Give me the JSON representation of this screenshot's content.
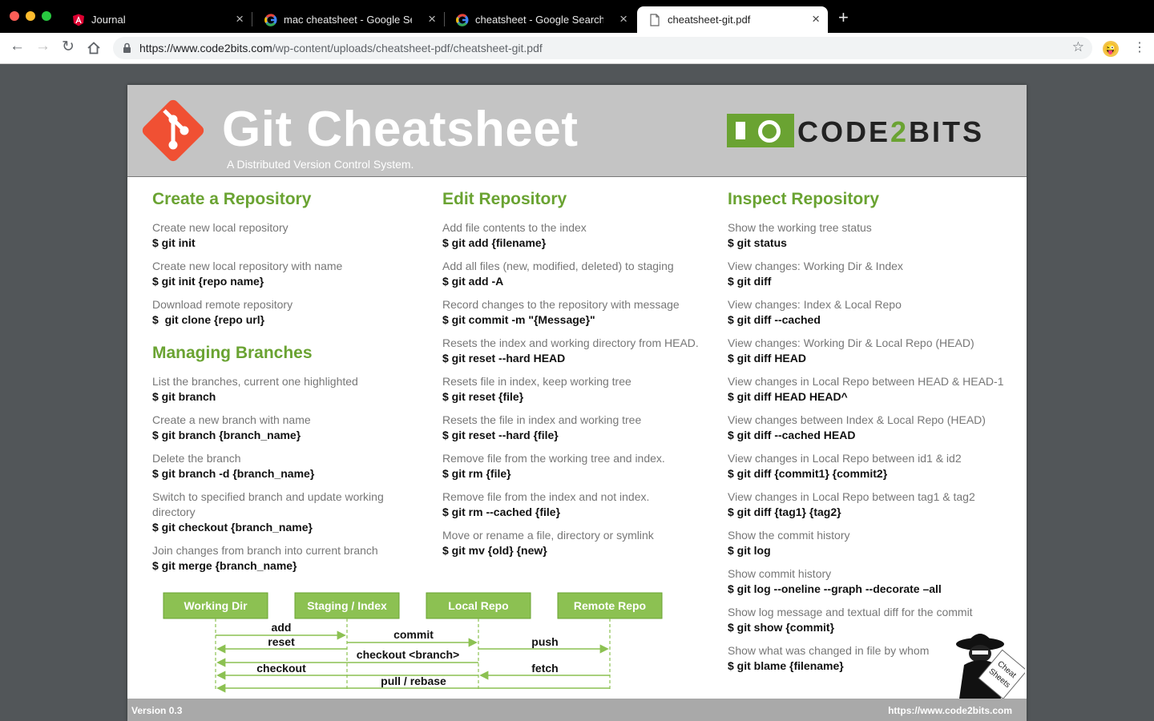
{
  "browser": {
    "tabs": [
      {
        "title": "Journal",
        "icon": "angular-icon"
      },
      {
        "title": "mac cheatsheet - Google Search",
        "icon": "google-icon"
      },
      {
        "title": "cheatsheet - Google Search",
        "icon": "google-icon"
      },
      {
        "title": "cheatsheet-git.pdf",
        "icon": "document-icon",
        "active": true
      }
    ],
    "url_domain": "https://www.code2bits.com",
    "url_path": "/wp-content/uploads/cheatsheet-pdf/cheatsheet-git.pdf"
  },
  "pdf": {
    "title": "Git Cheatsheet",
    "subtitle": "A Distributed Version Control System.",
    "brand": {
      "part1": "CODE",
      "part2": "2",
      "part3": "BITS"
    },
    "sections": {
      "create": {
        "title": "Create a Repository",
        "items": [
          {
            "desc": "Create new local repository",
            "cmd": "$ git init"
          },
          {
            "desc": "Create new local repository with name",
            "cmd": "$ git init {repo name}"
          },
          {
            "desc": "Download remote repository",
            "cmd": "$  git clone {repo url}"
          }
        ]
      },
      "branches": {
        "title": "Managing Branches",
        "items": [
          {
            "desc": "List the branches, current one highlighted",
            "cmd": "$ git branch"
          },
          {
            "desc": "Create a new branch with name",
            "cmd": "$ git branch {branch_name}"
          },
          {
            "desc": "Delete the branch",
            "cmd": "$ git branch -d {branch_name}"
          },
          {
            "desc": "Switch to specified branch and update working directory",
            "cmd": "$ git checkout {branch_name}"
          },
          {
            "desc": "Join changes from branch into current branch",
            "cmd": "$ git merge {branch_name}"
          }
        ]
      },
      "edit": {
        "title": "Edit Repository",
        "items": [
          {
            "desc": "Add file contents to the index",
            "cmd": "$ git add {filename}"
          },
          {
            "desc": "Add all files (new, modified, deleted) to staging",
            "cmd": "$ git add -A"
          },
          {
            "desc": "Record changes to the repository with message",
            "cmd": "$ git commit -m \"{Message}\""
          },
          {
            "desc": "Resets the index and working directory from HEAD.",
            "cmd": "$ git reset --hard HEAD"
          },
          {
            "desc": "Resets file in index, keep working tree",
            "cmd": "$ git reset {file}"
          },
          {
            "desc": "Resets the file in index and working tree",
            "cmd": "$ git reset --hard {file}"
          },
          {
            "desc": "Remove file from the working tree and index.",
            "cmd": "$ git rm {file}"
          },
          {
            "desc": "Remove file from the index and not index.",
            "cmd": "$ git rm --cached {file}"
          },
          {
            "desc": "Move or rename a file, directory or symlink",
            "cmd": "$ git mv {old} {new}"
          }
        ]
      },
      "inspect": {
        "title": "Inspect Repository",
        "items": [
          {
            "desc": "Show the working tree status",
            "cmd": "$ git status"
          },
          {
            "desc": "View changes: Working Dir & Index",
            "cmd": "$ git diff"
          },
          {
            "desc": "View changes: Index & Local Repo",
            "cmd": "$ git diff --cached"
          },
          {
            "desc": "View changes: Working Dir & Local Repo (HEAD)",
            "cmd": "$ git diff HEAD"
          },
          {
            "desc": "View changes in Local Repo between HEAD & HEAD-1",
            "cmd": "$ git diff HEAD HEAD^"
          },
          {
            "desc": "View changes between Index & Local Repo (HEAD)",
            "cmd": "$ git diff --cached HEAD"
          },
          {
            "desc": "View changes in Local Repo between id1 & id2",
            "cmd": "$ git diff {commit1} {commit2}"
          },
          {
            "desc": "View changes in Local Repo between tag1 & tag2",
            "cmd": "$ git diff {tag1} {tag2}"
          },
          {
            "desc": "Show the commit history",
            "cmd": "$ git log"
          },
          {
            "desc": "Show commit history",
            "cmd": "$ git log --oneline --graph --decorate –all"
          },
          {
            "desc": "Show log message and textual diff for the commit",
            "cmd": "$ git show {commit}"
          },
          {
            "desc": "Show what was changed in file by whom",
            "cmd": "$ git blame {filename}"
          }
        ]
      }
    },
    "workflow": {
      "boxes": [
        "Working Dir",
        "Staging / Index",
        "Local Repo",
        "Remote Repo"
      ],
      "arrows": [
        "add",
        "reset",
        "commit",
        "push",
        "checkout <branch>",
        "checkout",
        "fetch",
        "pull / rebase"
      ]
    },
    "badge": {
      "line1": "Cheat",
      "line2": "Sheets"
    },
    "footer": {
      "version": "Version 0.3",
      "site": "https://www.code2bits.com"
    }
  },
  "colors": {
    "accent": "#6aa332",
    "git_orange": "#f05033",
    "banner": "#c4c4c4"
  }
}
